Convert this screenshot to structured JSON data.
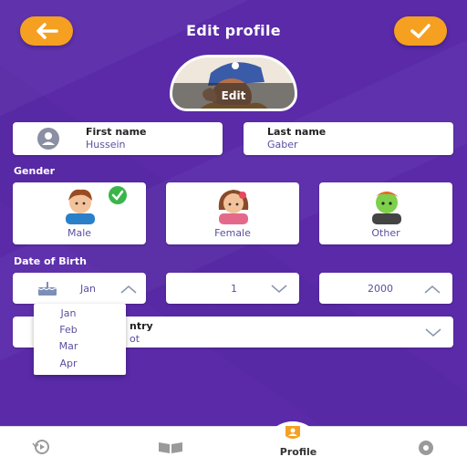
{
  "header": {
    "title": "Edit profile"
  },
  "avatar": {
    "edit_label": "Edit"
  },
  "first_name": {
    "label": "First name",
    "value": "Hussein"
  },
  "last_name": {
    "label": "Last name",
    "value": "Gaber"
  },
  "gender": {
    "section_label": "Gender",
    "options": [
      {
        "label": "Male",
        "selected": true
      },
      {
        "label": "Female",
        "selected": false
      },
      {
        "label": "Other",
        "selected": false
      }
    ]
  },
  "dob": {
    "section_label": "Date of Birth",
    "month": "Jan",
    "day": "1",
    "year": "2000",
    "month_options": [
      "Jan",
      "Feb",
      "Mar",
      "Apr"
    ]
  },
  "country": {
    "label_partial": "ntry",
    "value_partial": "ot"
  },
  "nav": {
    "profile_label": "Profile"
  },
  "colors": {
    "primary": "#5a2aa9",
    "accent": "#f5a021",
    "check": "#39b54a"
  }
}
